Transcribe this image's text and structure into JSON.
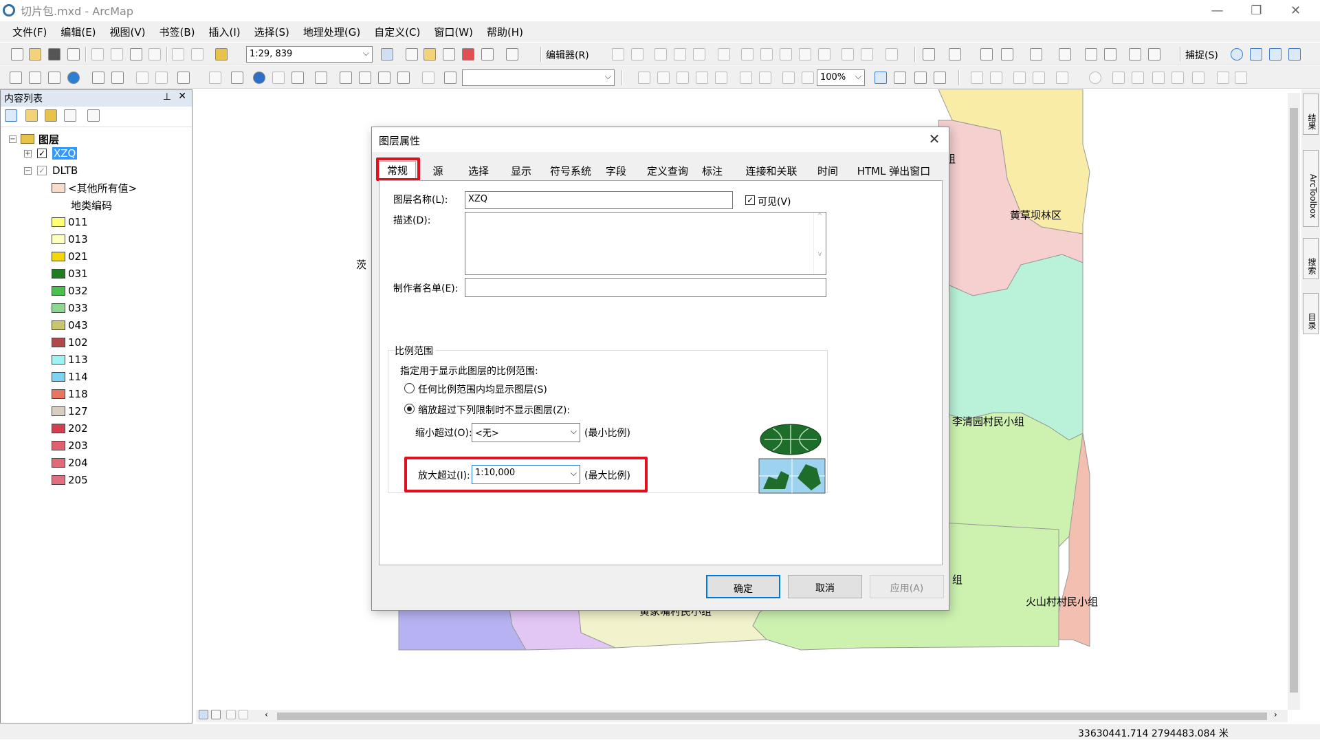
{
  "window": {
    "title": "切片包.mxd - ArcMap"
  },
  "menu": [
    "文件(F)",
    "编辑(E)",
    "视图(V)",
    "书签(B)",
    "插入(I)",
    "选择(S)",
    "地理处理(G)",
    "自定义(C)",
    "窗口(W)",
    "帮助(H)"
  ],
  "toolbar": {
    "scale": "1:29, 839",
    "editor": "编辑器(R)",
    "snapping": "捕捉(S)",
    "zoom": "100%"
  },
  "toc": {
    "title": "内容列表",
    "root": "图层",
    "layer1": "XZQ",
    "layer2": "DLTB",
    "other_values": "<其他所有值>",
    "field": "地类编码",
    "legend": [
      {
        "label": "011",
        "color": "#ffff73"
      },
      {
        "label": "013",
        "color": "#ffffbe"
      },
      {
        "label": "021",
        "color": "#f5d50e"
      },
      {
        "label": "031",
        "color": "#1f7d1f"
      },
      {
        "label": "032",
        "color": "#4cc04c"
      },
      {
        "label": "033",
        "color": "#8fd68f"
      },
      {
        "label": "043",
        "color": "#c8c66a"
      },
      {
        "label": "102",
        "color": "#b04a4a"
      },
      {
        "label": "113",
        "color": "#9ef2f2"
      },
      {
        "label": "114",
        "color": "#7dd3f0"
      },
      {
        "label": "118",
        "color": "#e8755e"
      },
      {
        "label": "127",
        "color": "#d7cdc0"
      },
      {
        "label": "202",
        "color": "#d04050"
      },
      {
        "label": "203",
        "color": "#e06070"
      },
      {
        "label": "204",
        "color": "#e06a78"
      },
      {
        "label": "205",
        "color": "#e07080"
      }
    ]
  },
  "map": {
    "labels": {
      "town_partial": "茨",
      "region_top": "组",
      "huangcaoba": "黄草坝林区",
      "liqingyuan": "李清园村民小组",
      "group_bottom": "组",
      "huoshancun": "火山村村民小组",
      "bottom_partial": "黄家嘴村民小组"
    },
    "colors": {
      "yellow": "#f8eca6",
      "pink": "#f6cfcf",
      "mint": "#b9f2d8",
      "green": "#cdf2b0",
      "lilac": "#e2c7f5",
      "purple": "#b7b2f2",
      "cream": "#f2f2cc",
      "salmon": "#f3bfb0"
    }
  },
  "status": {
    "coords": "33630441.714  2794483.084 米"
  },
  "dialog": {
    "title": "图层属性",
    "tabs": [
      "常规",
      "源",
      "选择",
      "显示",
      "符号系统",
      "字段",
      "定义查询",
      "标注",
      "连接和关联",
      "时间",
      "HTML 弹出窗口"
    ],
    "layer_name_label": "图层名称(L):",
    "layer_name_value": "XZQ",
    "visible_label": "可见(V)",
    "description_label": "描述(D):",
    "credits_label": "制作者名单(E):",
    "scale_group": "比例范围",
    "scale_desc": "指定用于显示此图层的比例范围:",
    "radio_any": "任何比例范围内均显示图层(S)",
    "radio_limit": "缩放超过下列限制时不显示图层(Z):",
    "out_beyond_label": "缩小超过(O):",
    "out_beyond_value": "<无>",
    "min_scale": "(最小比例)",
    "in_beyond_label": "放大超过(I):",
    "in_beyond_value": "1:10,000",
    "max_scale": "(最大比例)",
    "ok": "确定",
    "cancel": "取消",
    "apply": "应用(A)"
  }
}
